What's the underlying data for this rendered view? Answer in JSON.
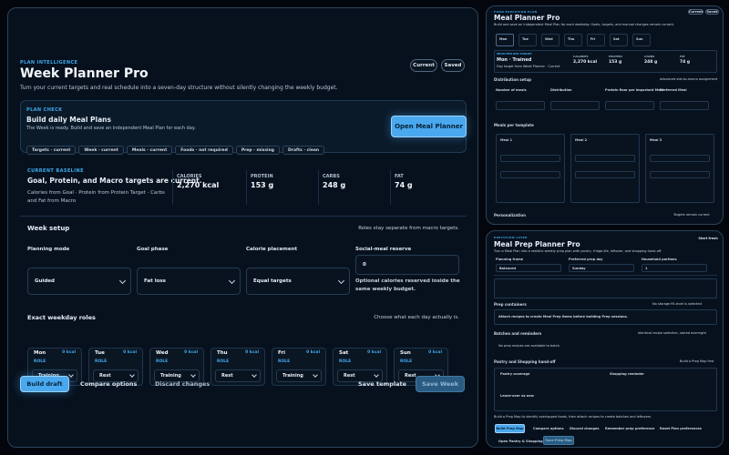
{
  "main": {
    "eyebrow": "PLAN INTELLIGENCE",
    "title": "Week Planner Pro",
    "subtitle": "Turn your current targets and real schedule into a seven-day structure without silently changing the weekly budget.",
    "btn_current": "Current",
    "btn_saved": "Saved",
    "plan_check": {
      "eyebrow": "PLAN CHECK",
      "heading": "Build daily Meal Plans",
      "text": "The Week is ready. Build and save an independent Meal Plan for each day.",
      "chips": [
        "Targets · current",
        "Week · current",
        "Meals · current",
        "Foods · not required",
        "Prep · missing",
        "Drafts · clean"
      ],
      "action": "Open Meal Planner"
    },
    "baseline": {
      "eyebrow": "CURRENT BASELINE",
      "heading": "Goal, Protein, and Macro targets are current.",
      "text": "Calories from Goal · Protein from Protein Target · Carbs and Fat from Macro",
      "stats": [
        {
          "label": "CALORIES",
          "value": "2,270 kcal"
        },
        {
          "label": "PROTEIN",
          "value": "153 g"
        },
        {
          "label": "CARBS",
          "value": "248 g"
        },
        {
          "label": "FAT",
          "value": "74 g"
        }
      ]
    },
    "week_setup": {
      "heading": "Week setup",
      "note": "Roles stay separate from macro targets.",
      "fields": [
        {
          "label": "Planning mode",
          "value": "Guided"
        },
        {
          "label": "Goal phase",
          "value": "Fat loss"
        },
        {
          "label": "Calorie placement",
          "value": "Equal targets"
        },
        {
          "label": "Social-meal reserve",
          "value": "0"
        }
      ],
      "reserve_help": "Optional calories reserved inside the same weekly budget."
    },
    "roles": {
      "heading": "Exact weekday roles",
      "note": "Choose what each day actually is.",
      "role_label": "ROLE",
      "days": [
        {
          "name": "Mon",
          "kcal": "0 kcal",
          "role": "Training"
        },
        {
          "name": "Tue",
          "kcal": "0 kcal",
          "role": "Rest"
        },
        {
          "name": "Wed",
          "kcal": "0 kcal",
          "role": "Training"
        },
        {
          "name": "Thu",
          "kcal": "0 kcal",
          "role": "Rest"
        },
        {
          "name": "Fri",
          "kcal": "0 kcal",
          "role": "Training"
        },
        {
          "name": "Sat",
          "kcal": "0 kcal",
          "role": "Rest"
        },
        {
          "name": "Sun",
          "kcal": "0 kcal",
          "role": "Rest"
        }
      ]
    },
    "footer": {
      "build": "Build draft",
      "compare": "Compare options",
      "discard": "Discard changes",
      "template": "Save template",
      "save": "Save Week"
    }
  },
  "meal_planner": {
    "eyebrow": "FOOD EXECUTION PLAN",
    "title": "Meal Planner Pro",
    "subtitle": "Build and save an independent Meal Plan for each weekday. Goals, targets, and manual changes remain current.",
    "btns": [
      "Current",
      "Saved"
    ],
    "days": [
      "Mon",
      "Tue",
      "Wed",
      "Thu",
      "Fri",
      "Sat",
      "Sun"
    ],
    "selected": {
      "eyebrow": "SELECTED DAY TARGET",
      "day": "Mon · Trained",
      "text": "Day target from Week Planner · Current"
    },
    "stats": [
      {
        "label": "CALORIES",
        "value": "2,270 kcal"
      },
      {
        "label": "PROTEIN",
        "value": "153 g"
      },
      {
        "label": "CARBS",
        "value": "248 g"
      },
      {
        "label": "FAT",
        "value": "74 g"
      }
    ],
    "distribution": "Distribution setup",
    "distribution_note": "Advanced slot-to-macro assignment",
    "fields": [
      "Number of meals",
      "Distribution",
      "Protein floor per important Meal",
      "Preferred Meal"
    ],
    "meals_heading": "Meals per template",
    "meal_cards": [
      "Meal 1",
      "Meal 2",
      "Meal 3"
    ],
    "personalization": "Personalization",
    "personalization_note": "Targets remain current"
  },
  "meal_prep": {
    "eyebrow": "EXECUTION LAYER",
    "title": "Meal Prep Planner Pro",
    "subtitle": "Turn a Meal Plan into a realistic weekly prep plan with pantry, fridge-life, leftover, and shopping hand-off.",
    "btn": "Start fresh",
    "fields": [
      {
        "label": "Planning frame",
        "value": "Balanced"
      },
      {
        "label": "Preferred prep day",
        "value": "Sunday"
      },
      {
        "label": "Household portions",
        "value": "1"
      }
    ],
    "prep_heading": "Prep containers",
    "prep_note": "No storage fill-level is selected",
    "prep_msg": "Attach recipes to create Meal Prep items before building Prep sessions.",
    "batch_heading": "Batches and reminders",
    "batch_note": "Identical recipe selection, stored overnight",
    "batch_msg": "No prep recipes are available to batch.",
    "pantry_heading": "Pantry and Shopping hand-off",
    "pantry_note": "Build a Prep Map first",
    "pantry_fields": [
      "Pantry coverage",
      "Shopping reminder",
      "Leave-over as new"
    ],
    "bottom_msg": "Build a Prep Map to identify overlapped foods, then attach recipes to create batches and leftovers.",
    "buttons": [
      "Build Prep Map",
      "Compare options",
      "Discard changes",
      "Remember prep preference",
      "Reset Plan preferences"
    ],
    "footer_links": [
      "Open Pantry & Shopping",
      "Save Prep Map"
    ]
  }
}
